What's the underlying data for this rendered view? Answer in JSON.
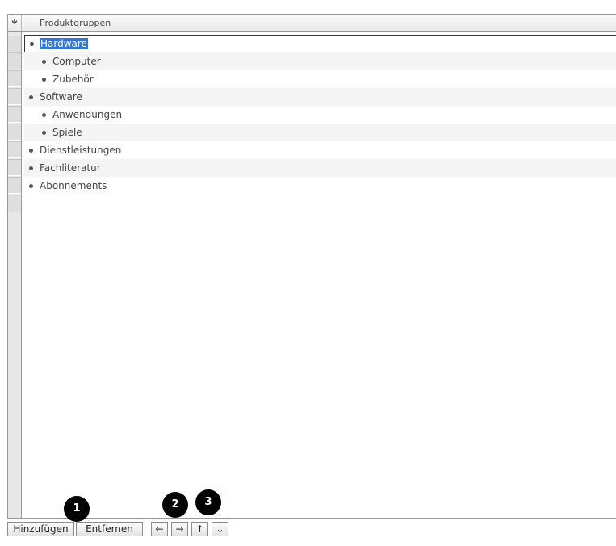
{
  "grid": {
    "sort_icon": "down-arrow-icon",
    "column_title": "Produktgruppen"
  },
  "tree": {
    "items": [
      {
        "label": "Hardware",
        "level": 0,
        "selected": true
      },
      {
        "label": "Computer",
        "level": 1
      },
      {
        "label": "Zubehör",
        "level": 1
      },
      {
        "label": "Software",
        "level": 0
      },
      {
        "label": "Anwendungen",
        "level": 1
      },
      {
        "label": "Spiele",
        "level": 1
      },
      {
        "label": "Dienstleistungen",
        "level": 0
      },
      {
        "label": "Fachliteratur",
        "level": 0
      },
      {
        "label": "Abonnements",
        "level": 0
      }
    ]
  },
  "toolbar": {
    "add_label": "Hinzufügen",
    "remove_label": "Entfernen",
    "left_label": "←",
    "right_label": "→",
    "up_label": "↑",
    "down_label": "↓"
  },
  "callouts": {
    "one": "1",
    "two": "2",
    "three": "3"
  },
  "colors": {
    "selection": "#3376d6",
    "callout_bg": "#000000"
  }
}
